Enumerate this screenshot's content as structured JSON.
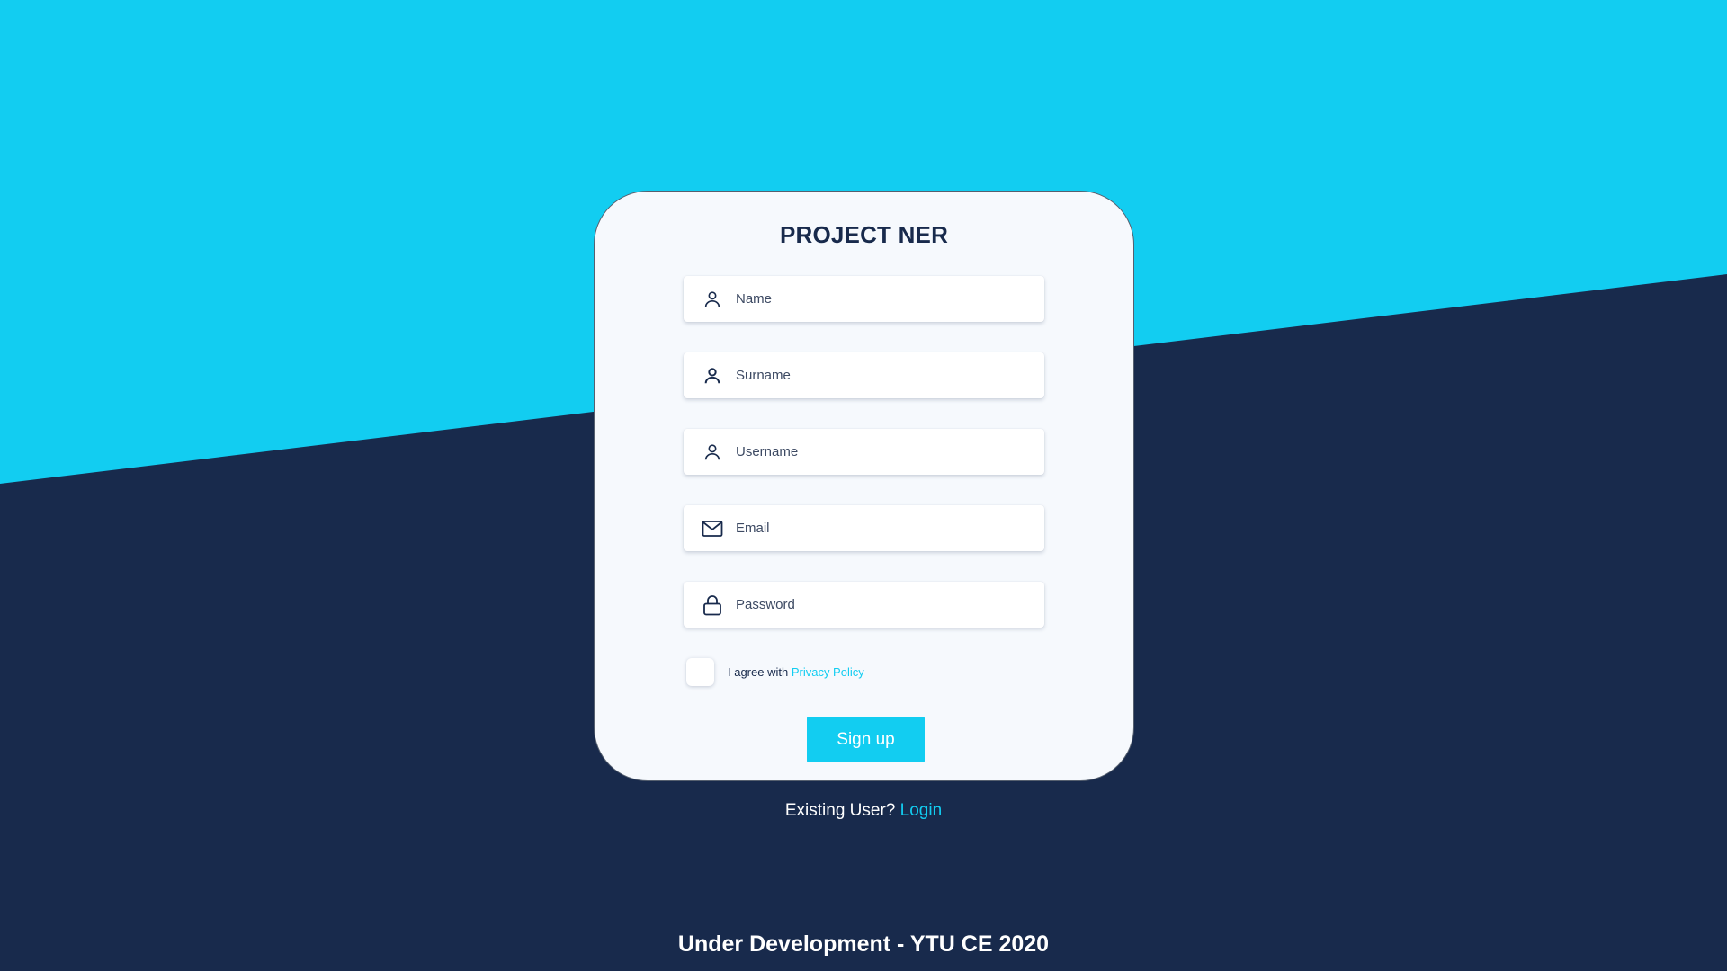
{
  "colors": {
    "accent": "#12cdf1",
    "navy": "#182a4c",
    "card": "#f6f9fd"
  },
  "card": {
    "title": "PROJECT NER"
  },
  "fields": [
    {
      "icon": "user-icon",
      "placeholder": "Name",
      "value": ""
    },
    {
      "icon": "user-icon",
      "placeholder": "Surname",
      "value": ""
    },
    {
      "icon": "user-icon",
      "placeholder": "Username",
      "value": ""
    },
    {
      "icon": "mail-icon",
      "placeholder": "Email",
      "value": ""
    },
    {
      "icon": "lock-icon",
      "placeholder": "Password",
      "value": ""
    }
  ],
  "agreement": {
    "text": "I agree with ",
    "link": "Privacy Policy",
    "checked": false
  },
  "signup_label": "Sign up",
  "existing": {
    "text": "Existing User? ",
    "link": "Login"
  },
  "footer": "Under Development - YTU CE 2020"
}
